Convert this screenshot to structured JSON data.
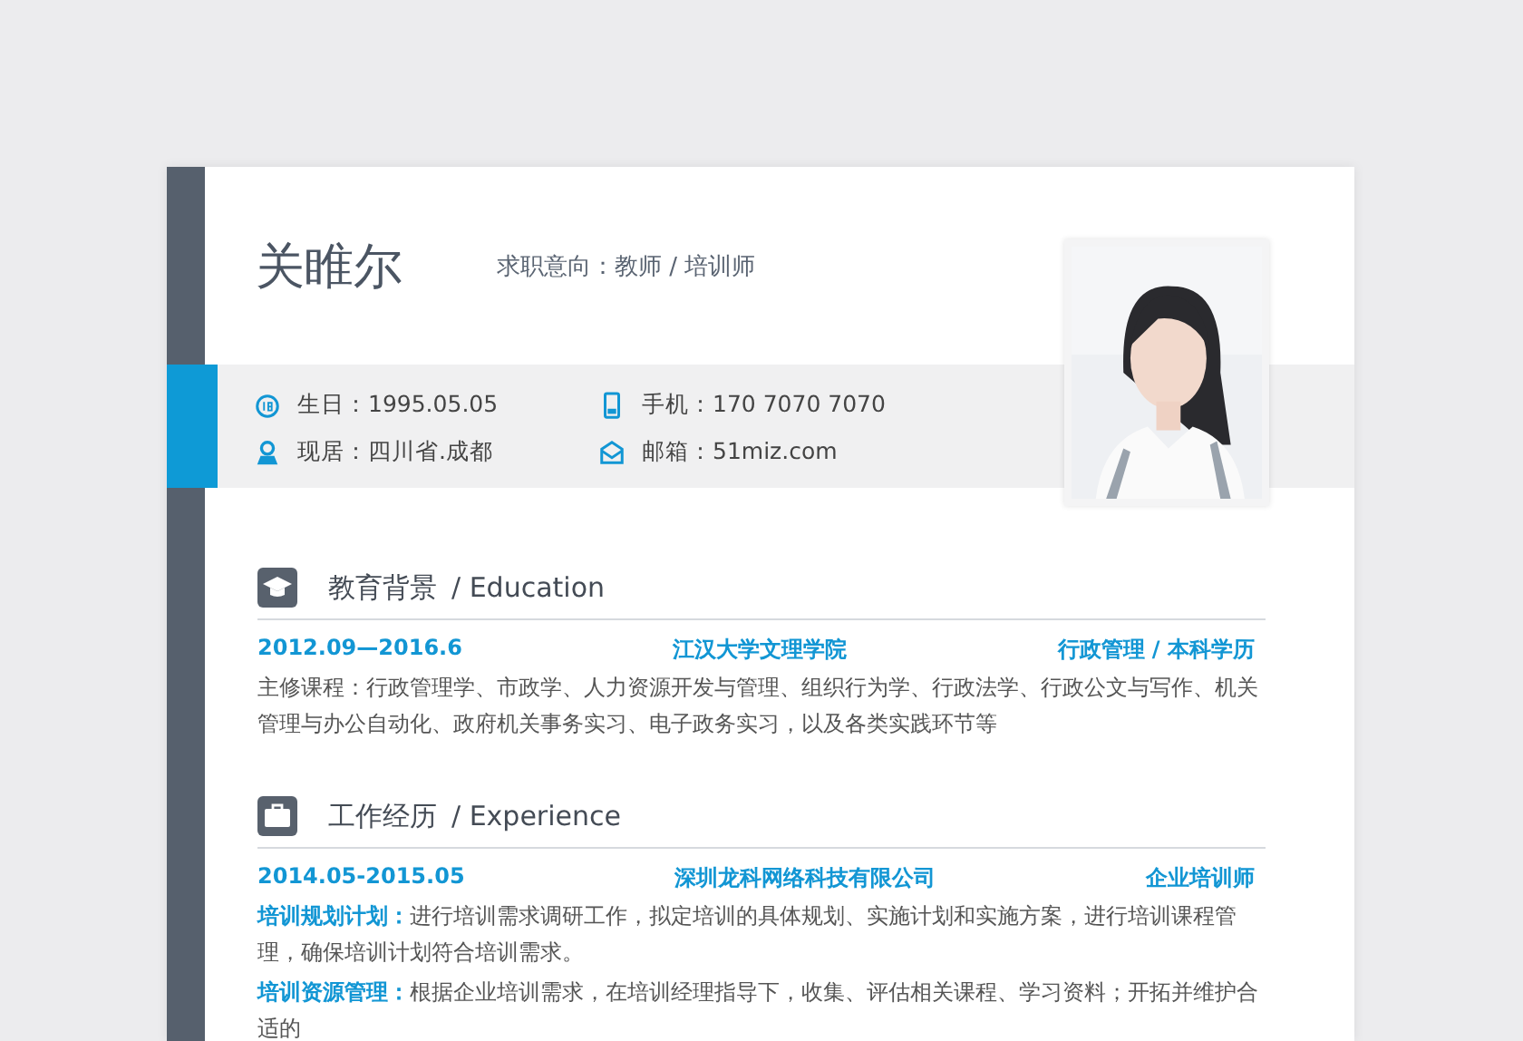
{
  "header": {
    "name": "关睢尔",
    "intent": "求职意向：教师 / 培训师"
  },
  "info": [
    {
      "kind": "birthday",
      "text": "生日：1995.05.05"
    },
    {
      "kind": "phone",
      "text": "手机：170 7070 7070"
    },
    {
      "kind": "location",
      "text": "现居：四川省.成都"
    },
    {
      "kind": "mail",
      "text": "邮箱：51miz.com"
    }
  ],
  "sections": [
    {
      "kind": "education",
      "title": "教育背景",
      "subtitle": "/ Education",
      "entries": [
        {
          "date": "2012.09—2016.6",
          "org": "江汉大学文理学院",
          "role": "行政管理 / 本科学历",
          "paragraphs": [
            {
              "text": "主修课程：行政管理学、市政学、人力资源开发与管理、组织行为学、行政法学、行政公文与写作、机关管理与办公自动化、政府机关事务实习、电子政务实习，以及各类实践环节等"
            }
          ]
        }
      ]
    },
    {
      "kind": "work",
      "title": "工作经历",
      "subtitle": "/ Experience",
      "entries": [
        {
          "date": "2014.05-2015.05",
          "org": "深圳龙科网络科技有限公司",
          "role": "企业培训师",
          "paragraphs": [
            {
              "lead": "培训规划计划：",
              "text": "进行培训需求调研工作，拟定培训的具体规划、实施计划和实施方案，进行培训课程管理，确保培训计划符合培训需求。"
            },
            {
              "lead": "培训资源管理：",
              "text": "根据企业培训需求，在培训经理指导下，收集、评估相关课程、学习资料；开拓并维护合适的"
            }
          ]
        }
      ]
    }
  ]
}
